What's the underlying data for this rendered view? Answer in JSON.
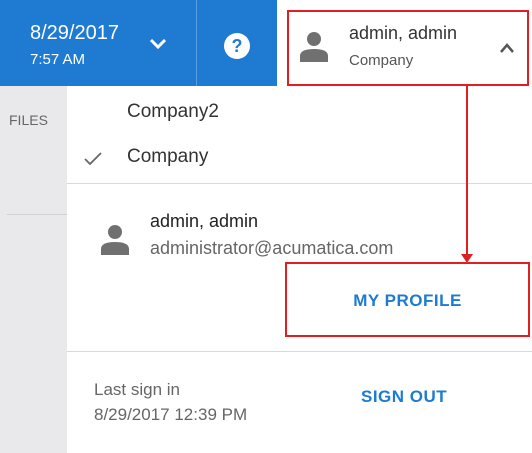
{
  "header": {
    "date": "8/29/2017",
    "time": "7:57 AM",
    "help_icon": "question-icon",
    "user_name": "admin, admin",
    "company": "Company"
  },
  "left_panel": {
    "label": "FILES"
  },
  "dropdown": {
    "companies": [
      {
        "label": "Company2",
        "selected": false
      },
      {
        "label": "Company",
        "selected": true
      }
    ],
    "profile": {
      "name": "admin, admin",
      "email": "administrator@acumatica.com"
    },
    "my_profile_label": "MY PROFILE",
    "last_sign_in_label": "Last sign in",
    "last_sign_in_date": "8/29/2017 12:39 PM",
    "sign_out_label": "SIGN OUT"
  },
  "colors": {
    "accent": "#1e7bd1",
    "highlight": "#e02020"
  }
}
